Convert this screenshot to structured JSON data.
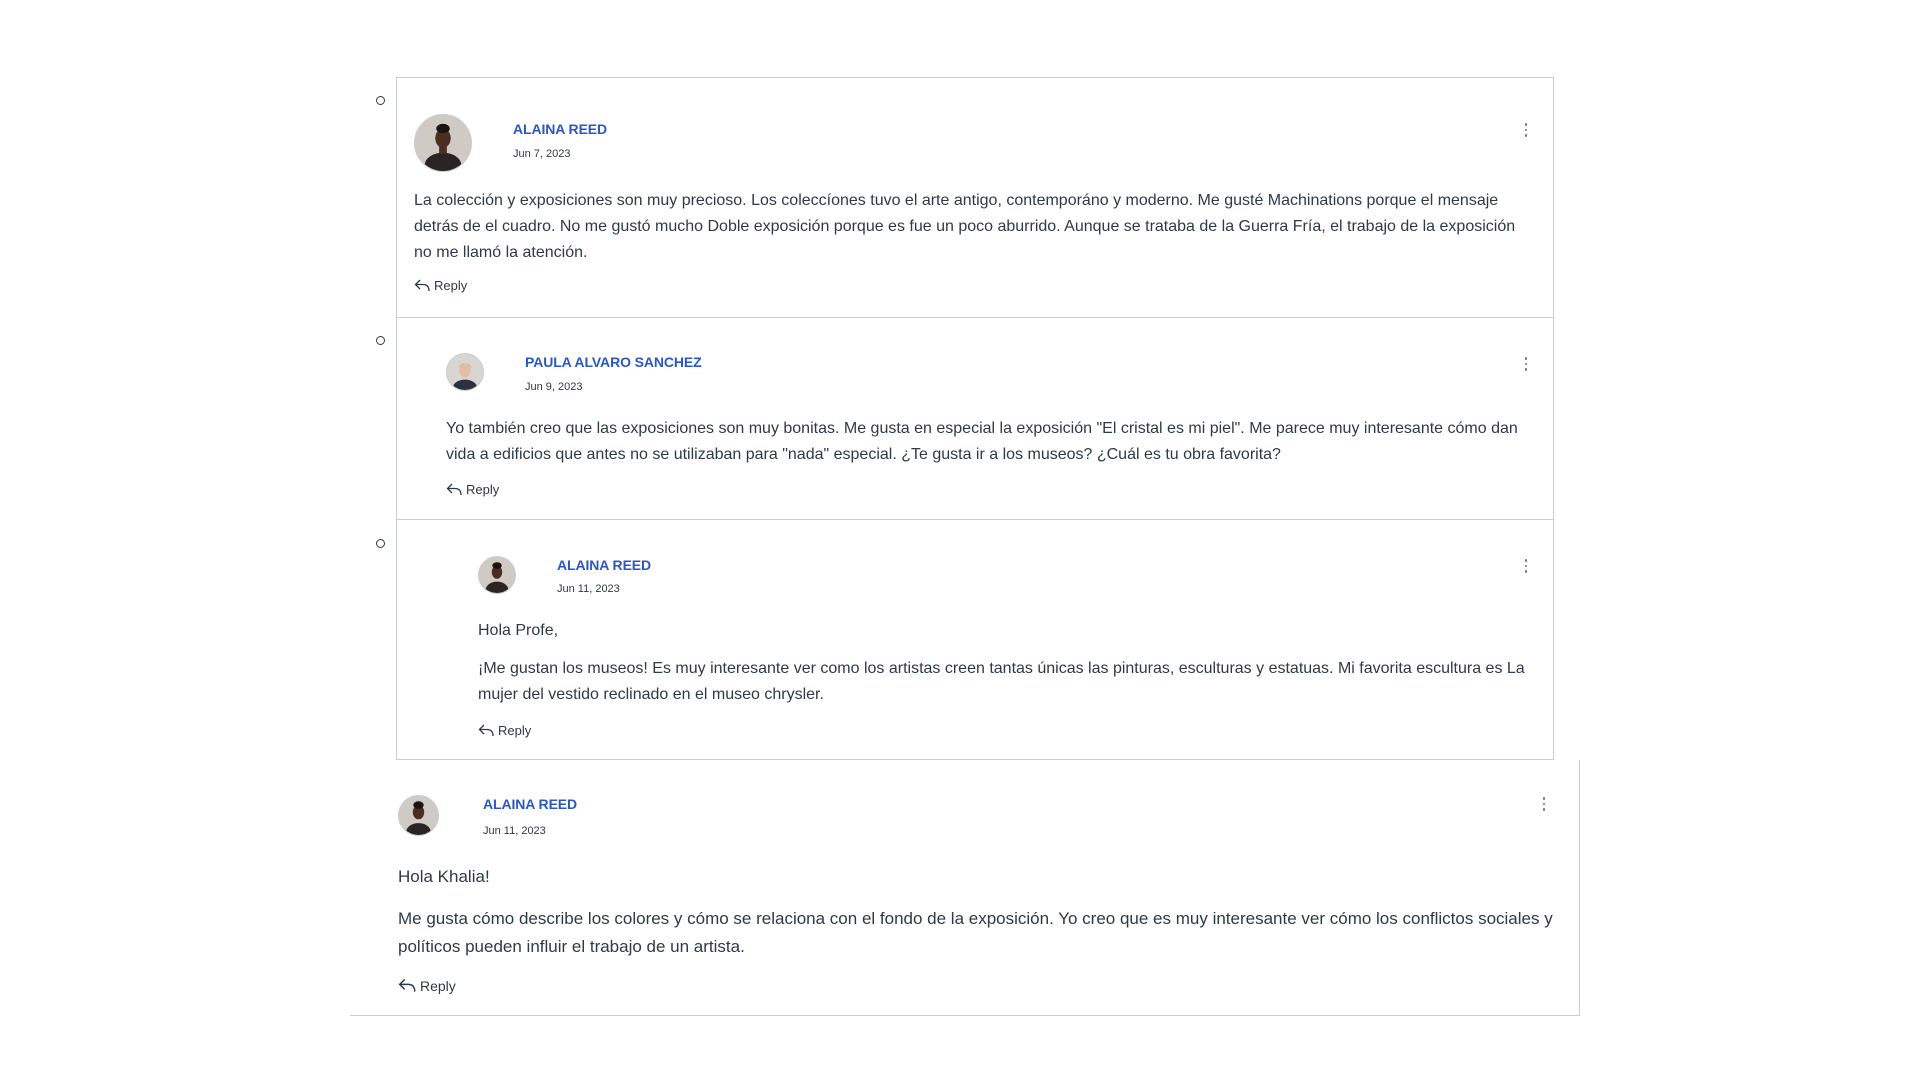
{
  "comments": [
    {
      "author": "ALAINA REED",
      "date": "Jun 7, 2023",
      "paragraphs": [
        "La colección y exposiciones son muy precioso. Los coleccíones tuvo el arte antigo, contemporáno y moderno. Me gusté Machinations porque el mensaje detrás de el cuadro. No me gustó mucho Doble exposición porque es fue un poco aburrido. Aunque se trataba de la Guerra Fría, el trabajo de la exposición no me llamó la atención."
      ],
      "reply_label": "Reply"
    },
    {
      "author": "PAULA ALVARO SANCHEZ",
      "date": "Jun 9, 2023",
      "paragraphs": [
        "Yo también creo que las exposiciones son muy bonitas. Me gusta en especial la exposición \"El cristal es mi piel\". Me parece muy interesante cómo dan vida a edificios que antes no se utilizaban para \"nada\" especial. ¿Te gusta ir a los museos? ¿Cuál es tu obra favorita?"
      ],
      "reply_label": "Reply"
    },
    {
      "author": "ALAINA REED",
      "date": "Jun 11, 2023",
      "paragraphs": [
        "Hola Profe,",
        "¡Me gustan los museos! Es muy interesante ver como los artistas creen tantas únicas las pinturas, esculturas y estatuas. Mi favorita escultura es La mujer del vestido reclinado en el museo chrysler."
      ],
      "reply_label": "Reply"
    },
    {
      "author": "ALAINA REED",
      "date": "Jun 11, 2023",
      "paragraphs": [
        "Hola Khalia!",
        "Me gusta cómo describe los colores y cómo se relaciona con el fondo de la exposición. Yo creo que es muy interesante ver cómo los conflictos sociales y políticos pueden influir el trabajo de un artista."
      ],
      "reply_label": "Reply"
    }
  ],
  "icons": {
    "more": "kebab-vertical-icon",
    "reply": "reply-arrow-icon",
    "bullet": "list-bullet-circle"
  },
  "colors": {
    "author_link": "#2b57c4",
    "text": "#2d3b45",
    "border": "#c7cdd1"
  }
}
